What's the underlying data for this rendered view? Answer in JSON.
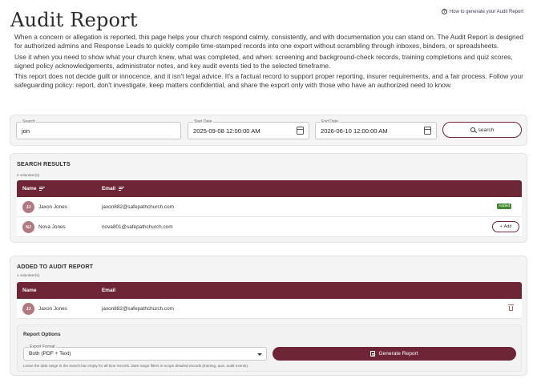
{
  "page": {
    "title": "Audit Report",
    "help_link": "How to generate your Audit Report",
    "intro": [
      "When a concern or allegation is reported, this page helps your church respond calmly, consistently, and with documentation you can stand on. The Audit Report is designed for authorized admins and Response Leads to quickly compile time-stamped records into one export without scrambling through inboxes, binders, or spreadsheets.",
      "Use it when you need to show what your church knew, what was completed, and when: screening and background-check records, training completions and quiz scores, signed policy acknowledgements, administrator notes, and key audit events tied to the selected timeframe.",
      "This report does not decide guilt or innocence, and it isn't legal advice. It's a factual record to support proper reporting, insurer requirements, and a fair process. Follow your safeguarding policy: report, don't investigate, keep matters confidential, and share the export only with those who have an authorized need to know."
    ]
  },
  "search": {
    "search_label": "Search",
    "search_value": "jon",
    "start_label": "Start Date",
    "start_value": "2025-09-08 12:00:00 AM",
    "end_label": "End Date",
    "end_value": "2026-06-10 12:00:00 AM",
    "button_label": "search"
  },
  "results": {
    "title": "SEARCH RESULTS",
    "count": "2 volunteer(s)",
    "columns": {
      "name": "Name",
      "email": "Email"
    },
    "rows": [
      {
        "initials": "JJ",
        "name": "Jaxon Jones",
        "email": "jaxon882@safepathchurch.com",
        "status": "Added"
      },
      {
        "initials": "NJ",
        "name": "Nova Jones",
        "email": "nova801@safepathchurch.com",
        "action": "Add"
      }
    ]
  },
  "added": {
    "title": "ADDED TO AUDIT REPORT",
    "count": "1 volunteer(s)",
    "columns": {
      "name": "Name",
      "email": "Email"
    },
    "rows": [
      {
        "initials": "JJ",
        "name": "Jaxon Jones",
        "email": "jaxon882@safepathchurch.com"
      }
    ]
  },
  "options": {
    "title": "Report Options",
    "format_label": "Export Format",
    "format_value": "Both (PDF + Text)",
    "generate_label": "Generate Report",
    "hint": "Leave the date range in the search bar empty for all-time records. Date range filters in-scope detailed records (training, quiz, audit events)."
  },
  "colors": {
    "accent": "#6e2637",
    "added_badge": "#3f8b2d",
    "avatar": "#b07880"
  }
}
